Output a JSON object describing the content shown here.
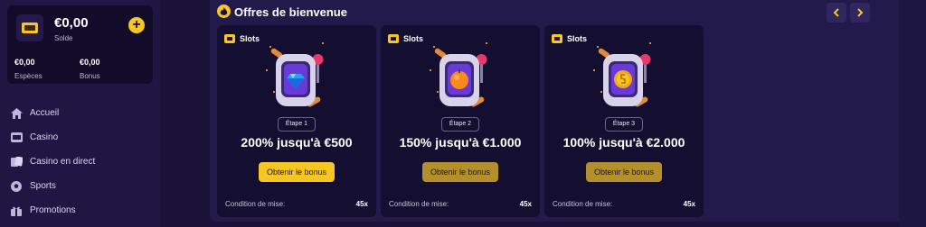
{
  "wallet": {
    "balance": "€0,00",
    "balance_label": "Solde",
    "add_label": "+",
    "cash_value": "€0,00",
    "cash_label": "Espèces",
    "bonus_value": "€0,00",
    "bonus_label": "Bonus"
  },
  "nav": {
    "items": [
      {
        "label": "Accueil",
        "icon": "home-icon"
      },
      {
        "label": "Casino",
        "icon": "casino-icon"
      },
      {
        "label": "Casino en direct",
        "icon": "cards-icon"
      },
      {
        "label": "Sports",
        "icon": "ball-icon"
      },
      {
        "label": "Promotions",
        "icon": "gift-icon"
      }
    ]
  },
  "main": {
    "title": "Offres de bienvenue",
    "cards": [
      {
        "tag": "Slots",
        "step": "Étape 1",
        "offer": "200% jusqu'à €500",
        "cta": "Obtenir le bonus",
        "condition_label": "Condition de mise:",
        "condition_value": "45x",
        "symbol": "diamond"
      },
      {
        "tag": "Slots",
        "step": "Étape 2",
        "offer": "150% jusqu'à €1.000",
        "cta": "Obtenir le bonus",
        "condition_label": "Condition de mise:",
        "condition_value": "45x",
        "symbol": "orange"
      },
      {
        "tag": "Slots",
        "step": "Étape 3",
        "offer": "100% jusqu'à €2.000",
        "cta": "Obtenir le bonus",
        "condition_label": "Condition de mise:",
        "condition_value": "45x",
        "symbol": "coin"
      }
    ]
  },
  "colors": {
    "accent": "#f7c621",
    "accent_muted": "#b3902b",
    "background": "#1a1238",
    "card": "#140e30"
  }
}
